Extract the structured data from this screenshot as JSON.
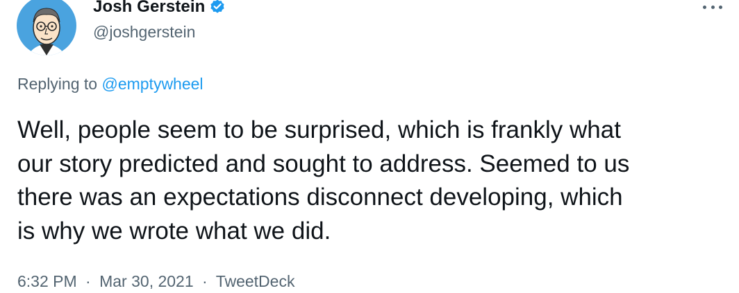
{
  "author": {
    "name": "Josh Gerstein",
    "handle": "@joshgerstein",
    "verified": true,
    "avatar_icon": "caricature-portrait-avatar"
  },
  "reply": {
    "prefix": "Replying to",
    "mention": "@emptywheel"
  },
  "tweet": {
    "text": "Well, people seem to be surprised, which is frankly what\nour story predicted and sought to address. Seemed to us\nthere was an expectations disconnect developing, which\nis why we wrote what we did."
  },
  "meta": {
    "time": "6:32 PM",
    "separator": "·",
    "date": "Mar 30, 2021",
    "source": "TweetDeck"
  },
  "icons": {
    "more": "more-horizontal-icon",
    "verified": "verified-badge-icon"
  },
  "colors": {
    "accent": "#1d9bf0",
    "text": "#0f1419",
    "secondary": "#536471",
    "avatar_background": "#4aa3df"
  }
}
